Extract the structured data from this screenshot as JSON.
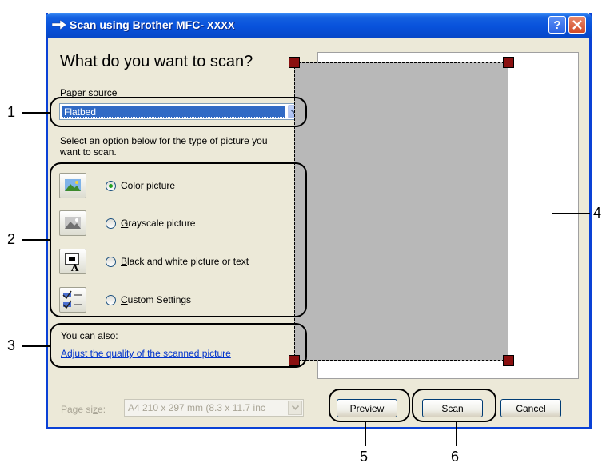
{
  "window": {
    "title_prefix": "Scan using Brother  MFC-",
    "title_model": "XXXX",
    "help_label": "?"
  },
  "main": {
    "heading": "What do you want to scan?",
    "paper_source_label": "Paper source",
    "paper_source_value": "Flatbed",
    "instruction_line1": "Select an option below for the type of picture you",
    "instruction_line2": "want to scan.",
    "options": [
      {
        "label": "Color picture",
        "selected": true
      },
      {
        "label": "Grayscale picture",
        "selected": false
      },
      {
        "label": "Black and white picture or text",
        "selected": false
      },
      {
        "label": "Custom Settings",
        "selected": false
      }
    ],
    "also_label": "You can also:",
    "adjust_link": "Adjust the quality of the scanned picture"
  },
  "footer": {
    "page_size_label": "Page size:",
    "page_size_value": "A4 210 x 297 mm (8.3 x 11.7 inc",
    "preview_button": "Preview",
    "scan_button": "Scan",
    "cancel_button": "Cancel"
  },
  "callouts": [
    "1",
    "2",
    "3",
    "4",
    "5",
    "6"
  ]
}
